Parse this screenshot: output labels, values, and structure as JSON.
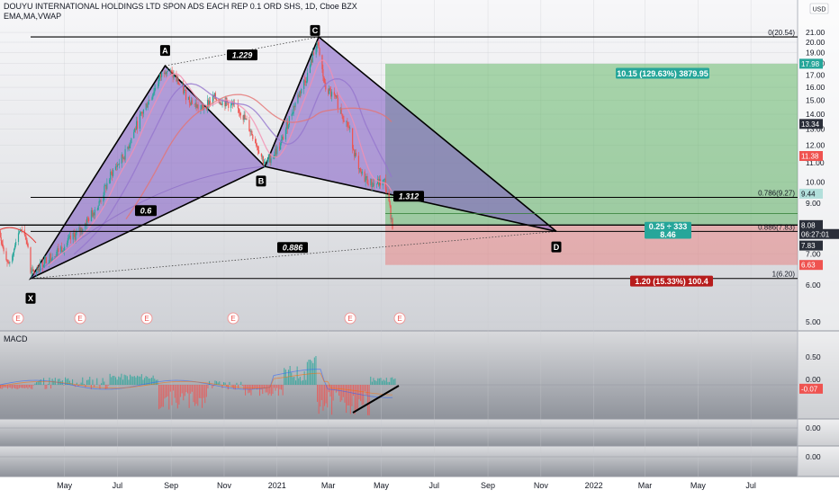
{
  "header": {
    "title": "DOUYU INTERNATIONAL HOLDINGS LTD SPON ADS EACH REP 0.1 ORD SHS, 1D, Cboe BZX",
    "indicators": "EMA,MA,VWAP",
    "currency_badge": "USD"
  },
  "chart_data": {
    "type": "line",
    "title": "DOUYU INTERNATIONAL HOLDINGS LTD SPON ADS EACH REP 0.1 ORD SHS, 1D, Cboe BZX",
    "x_tick_labels": [
      "May",
      "Jul",
      "Sep",
      "Nov",
      "2021",
      "Mar",
      "May",
      "Jul",
      "Sep",
      "Nov",
      "2022",
      "Mar",
      "May",
      "Jul"
    ],
    "y_tick_labels": [
      "21.00",
      "20.00",
      "19.00",
      "18.00",
      "17.00",
      "16.00",
      "15.00",
      "14.00",
      "13.00",
      "12.00",
      "11.00",
      "10.00",
      "9.00",
      "8.00",
      "7.00",
      "6.00",
      "5.00"
    ],
    "price_series": {
      "name": "Price",
      "points": [
        [
          "2020-03-23",
          6.3
        ],
        [
          "2020-04-10",
          6.8
        ],
        [
          "2020-05-01",
          7.3
        ],
        [
          "2020-05-20",
          7.9
        ],
        [
          "2020-06-10",
          9.0
        ],
        [
          "2020-06-25",
          10.5
        ],
        [
          "2020-07-10",
          11.5
        ],
        [
          "2020-07-25",
          13.5
        ],
        [
          "2020-08-10",
          15.5
        ],
        [
          "2020-08-25",
          17.6
        ],
        [
          "2020-09-05",
          16.8
        ],
        [
          "2020-09-20",
          15.2
        ],
        [
          "2020-10-05",
          14.3
        ],
        [
          "2020-10-20",
          15.2
        ],
        [
          "2020-11-05",
          14.8
        ],
        [
          "2020-11-20",
          14.2
        ],
        [
          "2020-12-05",
          12.5
        ],
        [
          "2020-12-18",
          10.9
        ],
        [
          "2021-01-05",
          12.0
        ],
        [
          "2021-01-20",
          14.5
        ],
        [
          "2021-02-05",
          17.0
        ],
        [
          "2021-02-16",
          20.0
        ],
        [
          "2021-02-25",
          16.0
        ],
        [
          "2021-03-10",
          15.0
        ],
        [
          "2021-03-25",
          13.0
        ],
        [
          "2021-04-05",
          10.5
        ],
        [
          "2021-04-20",
          9.9
        ],
        [
          "2021-05-05",
          10.0
        ],
        [
          "2021-05-14",
          8.1
        ]
      ]
    },
    "pattern": {
      "name": "Bat/Gartley harmonic pattern",
      "points": [
        {
          "label": "X",
          "date": "2020-03-23",
          "price": 6.2
        },
        {
          "label": "A",
          "date": "2020-08-25",
          "price": 17.8
        },
        {
          "label": "B",
          "date": "2020-12-18",
          "price": 10.8
        },
        {
          "label": "C",
          "date": "2021-02-18",
          "price": 20.54
        },
        {
          "label": "D",
          "date": "2021-11-01",
          "price": 7.83
        }
      ],
      "ratios": [
        {
          "label": "1.229",
          "between": "A-C"
        },
        {
          "label": "0.6",
          "between": "X-B"
        },
        {
          "label": "1.312",
          "between": "B-D"
        },
        {
          "label": "0.886",
          "between": "X-D"
        }
      ]
    },
    "fib_levels": [
      {
        "label": "0(20.54)",
        "price": 20.54
      },
      {
        "label": "0.786(9.27)",
        "price": 9.27
      },
      {
        "label": "0.886(7.83)",
        "price": 7.83
      },
      {
        "label": "1(6.20)",
        "price": 6.2
      }
    ],
    "position": {
      "type": "long",
      "entry": 8.08,
      "target": 17.98,
      "stop": 6.63,
      "profit_label": "10.15 (129.63%) 3879.95",
      "loss_label": "1.20 (15.33%) 100.4",
      "ratio_label": "0.25 ÷ 333",
      "rr_label": "8.46"
    },
    "price_badges": [
      {
        "text": "17.98",
        "price": 17.98,
        "color": "#26a69a"
      },
      {
        "text": "13.34",
        "price": 13.34,
        "color": "#2a2e39"
      },
      {
        "text": "11.38",
        "price": 11.38,
        "color": "#ef5350"
      },
      {
        "text": "9.44",
        "price": 9.44,
        "color": "#b2dfdb"
      },
      {
        "text": "8.08",
        "price": 8.08,
        "color": "#2a2e39"
      },
      {
        "text": "06:27:01",
        "price": 7.73,
        "color": "#2a2e39"
      },
      {
        "text": "7.83",
        "price": 7.3,
        "color": "#2a2e39"
      },
      {
        "text": "6.63",
        "price": 6.63,
        "color": "#ef5350"
      }
    ],
    "earnings_markers": [
      "E",
      "E",
      "E",
      "E",
      "E",
      "E",
      "E"
    ],
    "macd": {
      "label": "MACD",
      "y_tick_labels": [
        "0.50",
        "0.00"
      ],
      "current_value": "-0.07",
      "current_value_num": -0.07
    },
    "lower_panes": [
      {
        "value_label": "0.00"
      },
      {
        "value_label": "0.00"
      }
    ],
    "colors": {
      "pattern_fill": "#7e57c2",
      "profit_zone": "#4caf50",
      "loss_zone": "#ef5350",
      "candle_up": "#26a69a",
      "candle_down": "#ef5350"
    }
  }
}
